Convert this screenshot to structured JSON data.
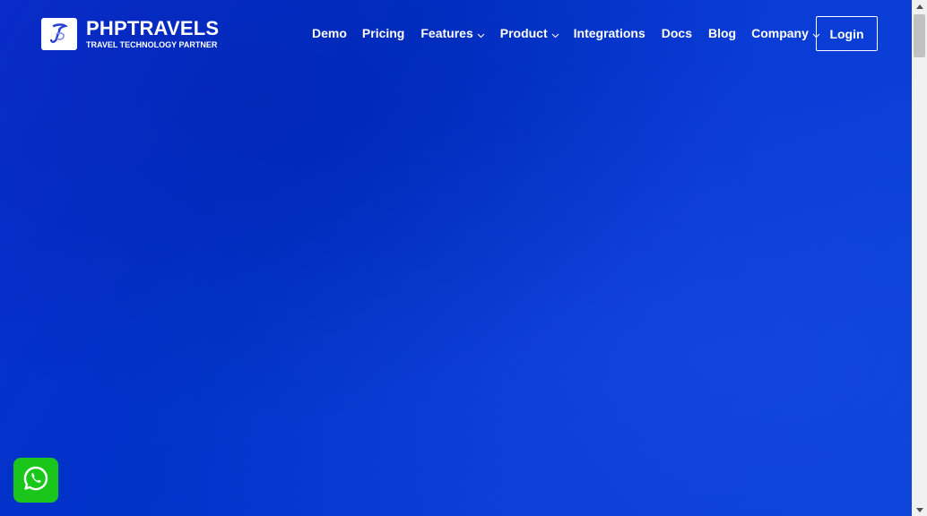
{
  "brand": {
    "name": "PHPTRAVELS",
    "tagline": "TRAVEL TECHNOLOGY PARTNER",
    "logo_icon": "phptravels-logo-icon"
  },
  "nav": {
    "items": [
      {
        "label": "Demo",
        "dropdown": false
      },
      {
        "label": "Pricing",
        "dropdown": false
      },
      {
        "label": "Features",
        "dropdown": true
      },
      {
        "label": "Product",
        "dropdown": true
      },
      {
        "label": "Integrations",
        "dropdown": false
      },
      {
        "label": "Docs",
        "dropdown": false
      },
      {
        "label": "Blog",
        "dropdown": false
      },
      {
        "label": "Company",
        "dropdown": true
      }
    ],
    "login_label": "Login"
  },
  "floating": {
    "whatsapp_icon": "whatsapp-icon"
  },
  "colors": {
    "background": "#0033c8",
    "whatsapp": "#1bc61b",
    "text": "#ffffff"
  }
}
